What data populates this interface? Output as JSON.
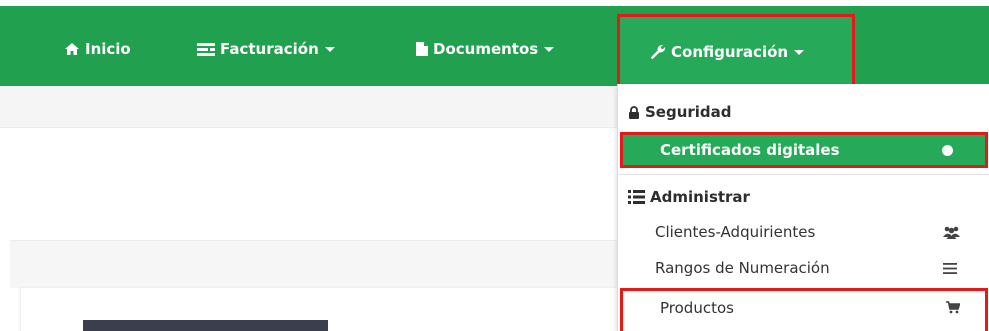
{
  "navbar": {
    "items": [
      {
        "label": "Inicio",
        "icon": "home-icon"
      },
      {
        "label": "Facturación",
        "icon": "billing-icon"
      },
      {
        "label": "Documentos",
        "icon": "document-icon"
      },
      {
        "label": "Configuración",
        "icon": "wrench-icon"
      }
    ]
  },
  "dropdown": {
    "security_header": {
      "label": "Seguridad",
      "icon": "lock-icon"
    },
    "security_items": [
      {
        "label": "Certificados digitales",
        "icon": "dot-icon",
        "state": "active"
      }
    ],
    "admin_header": {
      "label": "Administrar",
      "icon": "list-icon"
    },
    "admin_items": [
      {
        "label": "Clientes-Adquirientes",
        "icon": "users-icon"
      },
      {
        "label": "Rangos de Numeración",
        "icon": "bars-icon"
      },
      {
        "label": "Productos",
        "icon": "cart-icon"
      }
    ]
  },
  "colors": {
    "navbar": "#21a050",
    "active_item": "#26a958",
    "highlight_border": "#e31a1a"
  }
}
